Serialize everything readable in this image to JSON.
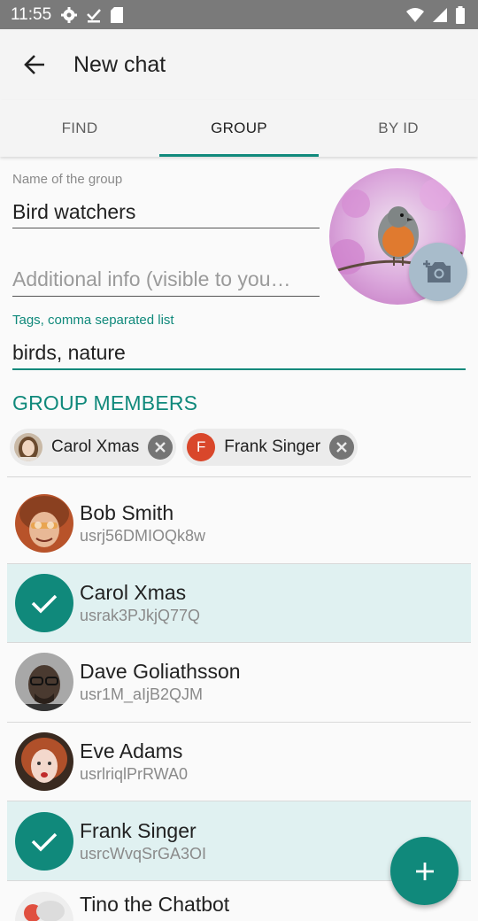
{
  "status_bar": {
    "time": "11:55",
    "left_icons": [
      "settings-icon",
      "download-done-icon",
      "sd-card-icon"
    ],
    "right_icons": [
      "wifi-icon",
      "signal-icon",
      "battery-icon"
    ]
  },
  "appbar": {
    "title": "New chat",
    "back_icon": "arrow-back-icon"
  },
  "tabs": [
    {
      "label": "FIND",
      "active": false
    },
    {
      "label": "GROUP",
      "active": true
    },
    {
      "label": "BY ID",
      "active": false
    }
  ],
  "form": {
    "name_label": "Name of the group",
    "name_value": "Bird watchers",
    "info_placeholder": "Additional info (visible to you…",
    "tags_label": "Tags, comma separated list",
    "tags_value": "birds, nature"
  },
  "section_title": "GROUP MEMBERS",
  "chips": [
    {
      "label": "Carol Xmas",
      "avatar": "photo"
    },
    {
      "label": "Frank Singer",
      "avatar_letter": "F"
    }
  ],
  "contacts": [
    {
      "name": "Bob Smith",
      "id": "usrj56DMIOQk8w",
      "selected": false
    },
    {
      "name": "Carol Xmas",
      "id": "usrak3PJkjQ77Q",
      "selected": true
    },
    {
      "name": "Dave Goliathsson",
      "id": "usr1M_aIjB2QJM",
      "selected": false
    },
    {
      "name": "Eve Adams",
      "id": "usrlriqlPrRWA0",
      "selected": false
    },
    {
      "name": "Frank Singer",
      "id": "usrcWvqSrGA3OI",
      "selected": true
    },
    {
      "name": "Tino the Chatbot",
      "id": "",
      "selected": false
    }
  ],
  "colors": {
    "accent": "#10897b",
    "selected_row": "#e0f1f1",
    "chip_letter_bg": "#d9472b"
  },
  "fab_icon": "add-icon"
}
